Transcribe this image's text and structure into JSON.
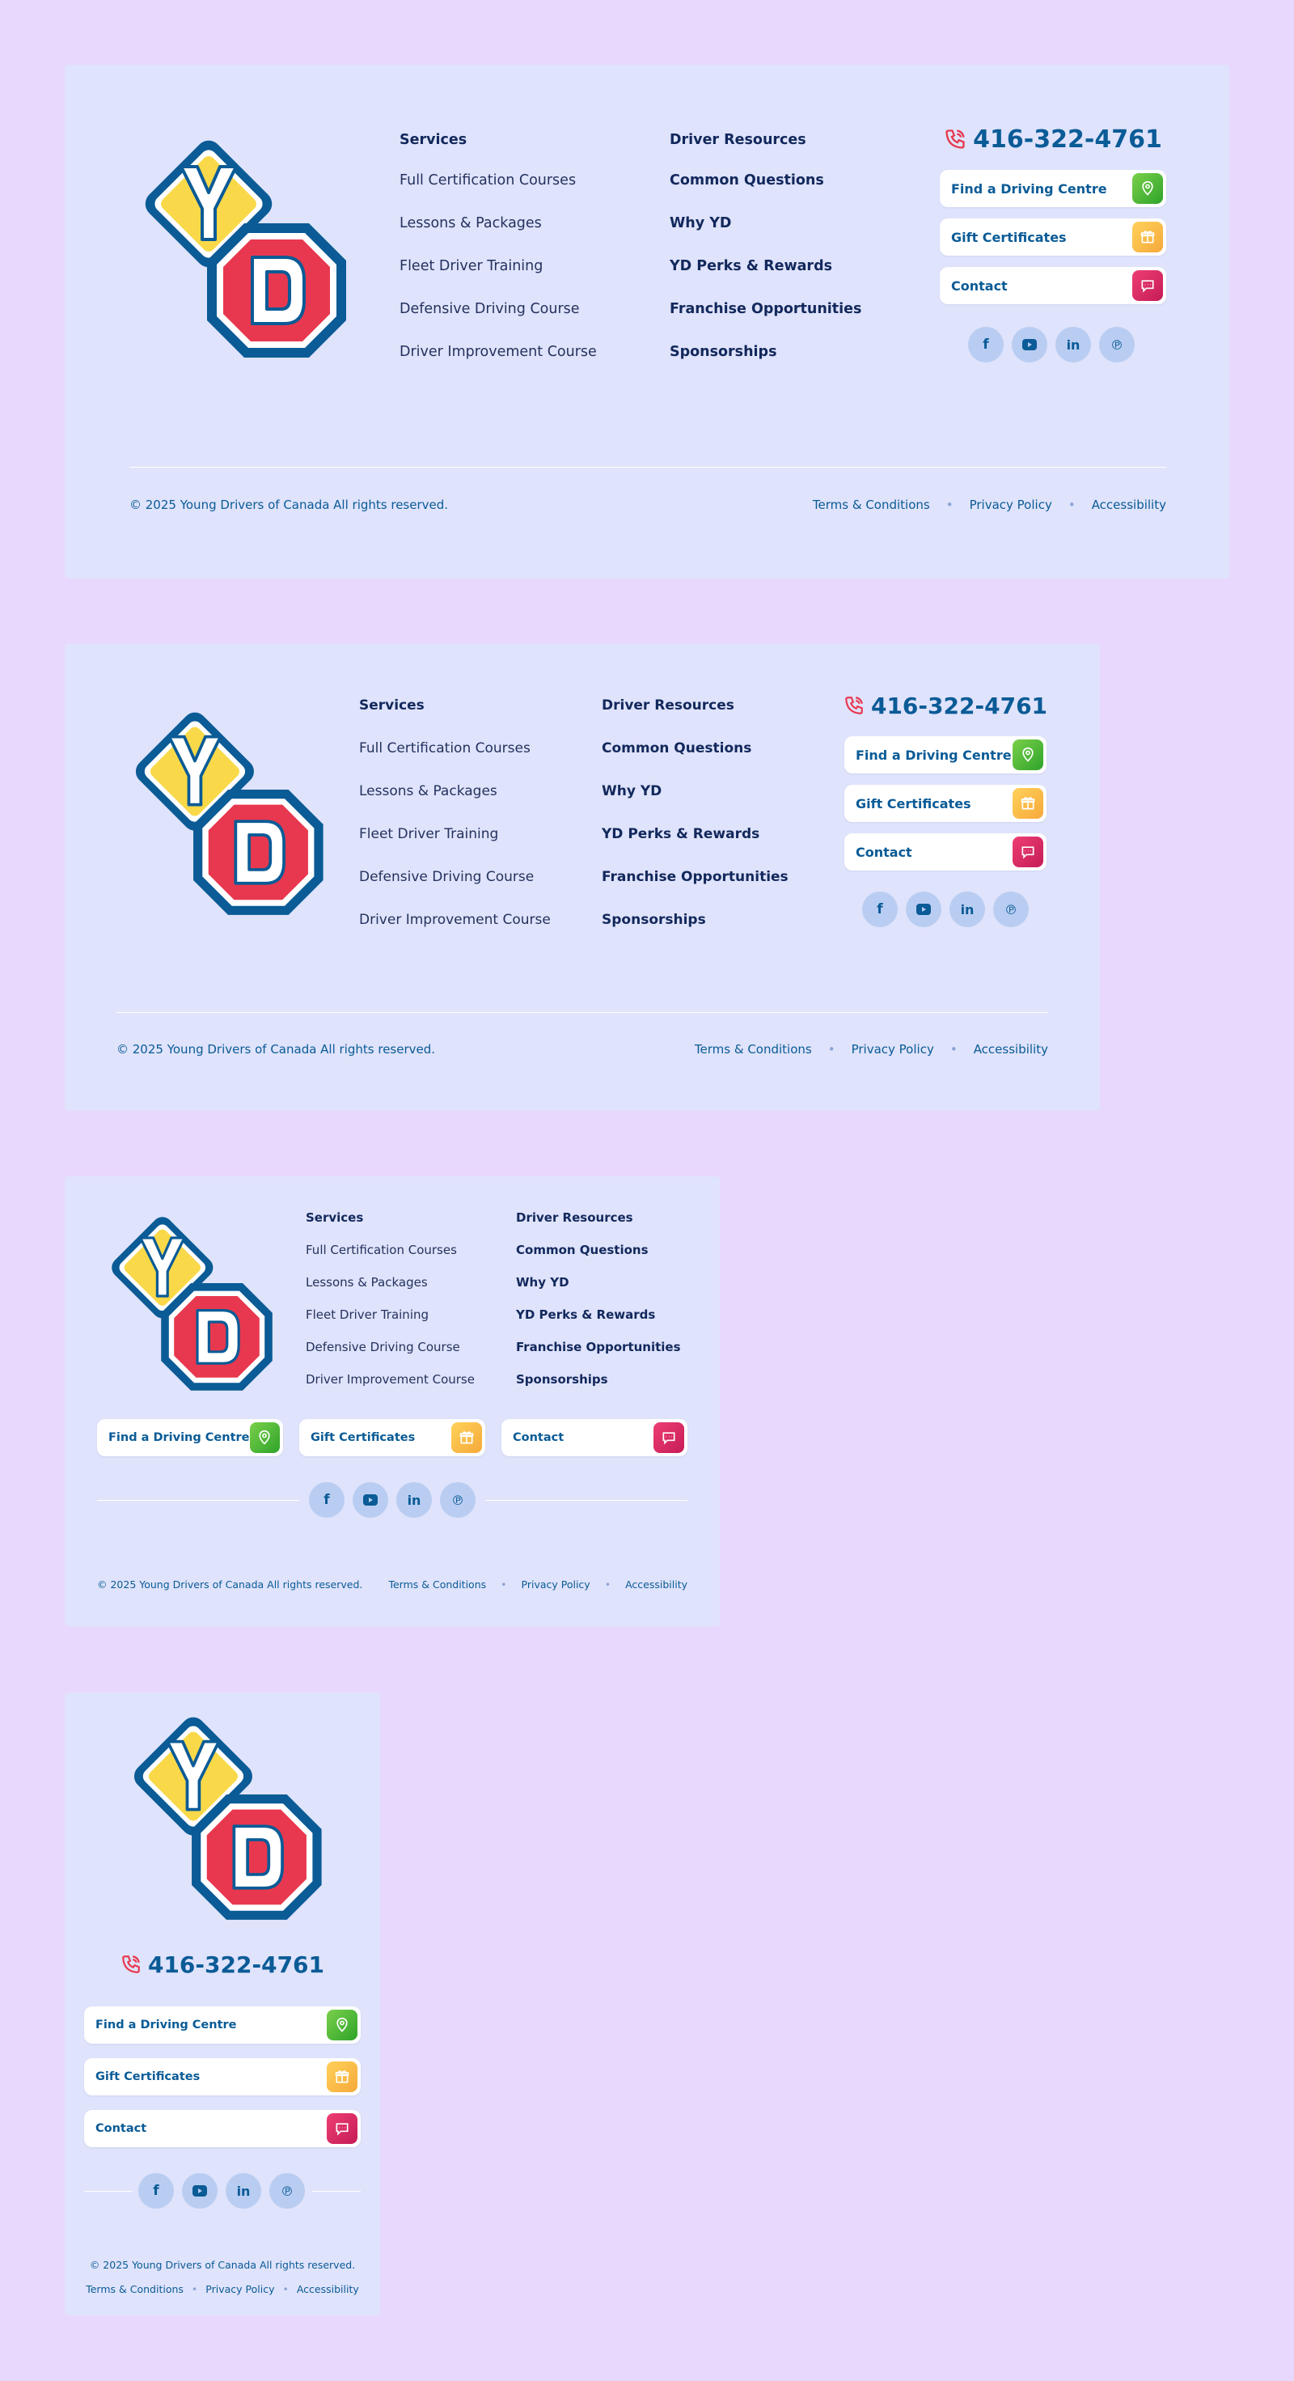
{
  "phone": "416-322-4761",
  "services": {
    "heading": "Services",
    "items": [
      "Full Certification Courses",
      "Lessons & Packages",
      "Fleet Driver Training",
      "Defensive Driving Course",
      "Driver Improvement Course"
    ]
  },
  "resources": {
    "heading": "Driver Resources",
    "items": [
      "Common Questions",
      "Why YD",
      "YD Perks & Rewards",
      "Franchise Opportunities",
      "Sponsorships"
    ]
  },
  "actions": {
    "find": "Find a Driving Centre",
    "gift": "Gift Certificates",
    "contact": "Contact"
  },
  "social_icons": [
    "facebook-icon",
    "youtube-icon",
    "linkedin-icon",
    "pinterest-icon"
  ],
  "copyright": "© 2025 Young Drivers of Canada All rights reserved.",
  "legal": {
    "terms": "Terms & Conditions",
    "privacy": "Privacy Policy",
    "accessibility": "Accessibility"
  },
  "logo": {
    "letter_top": "Y",
    "letter_bottom": "D"
  },
  "colors": {
    "page_bg": "#e8d8fd",
    "panel_bg": "#dfe3fb",
    "brand_blue": "#0a5b96",
    "navy_text": "#12285c",
    "logo_yellow": "#f9d949",
    "logo_red": "#e8384f",
    "find_green": "#2ea32a",
    "gift_orange": "#f6a93a",
    "contact_pink": "#c51b57"
  }
}
